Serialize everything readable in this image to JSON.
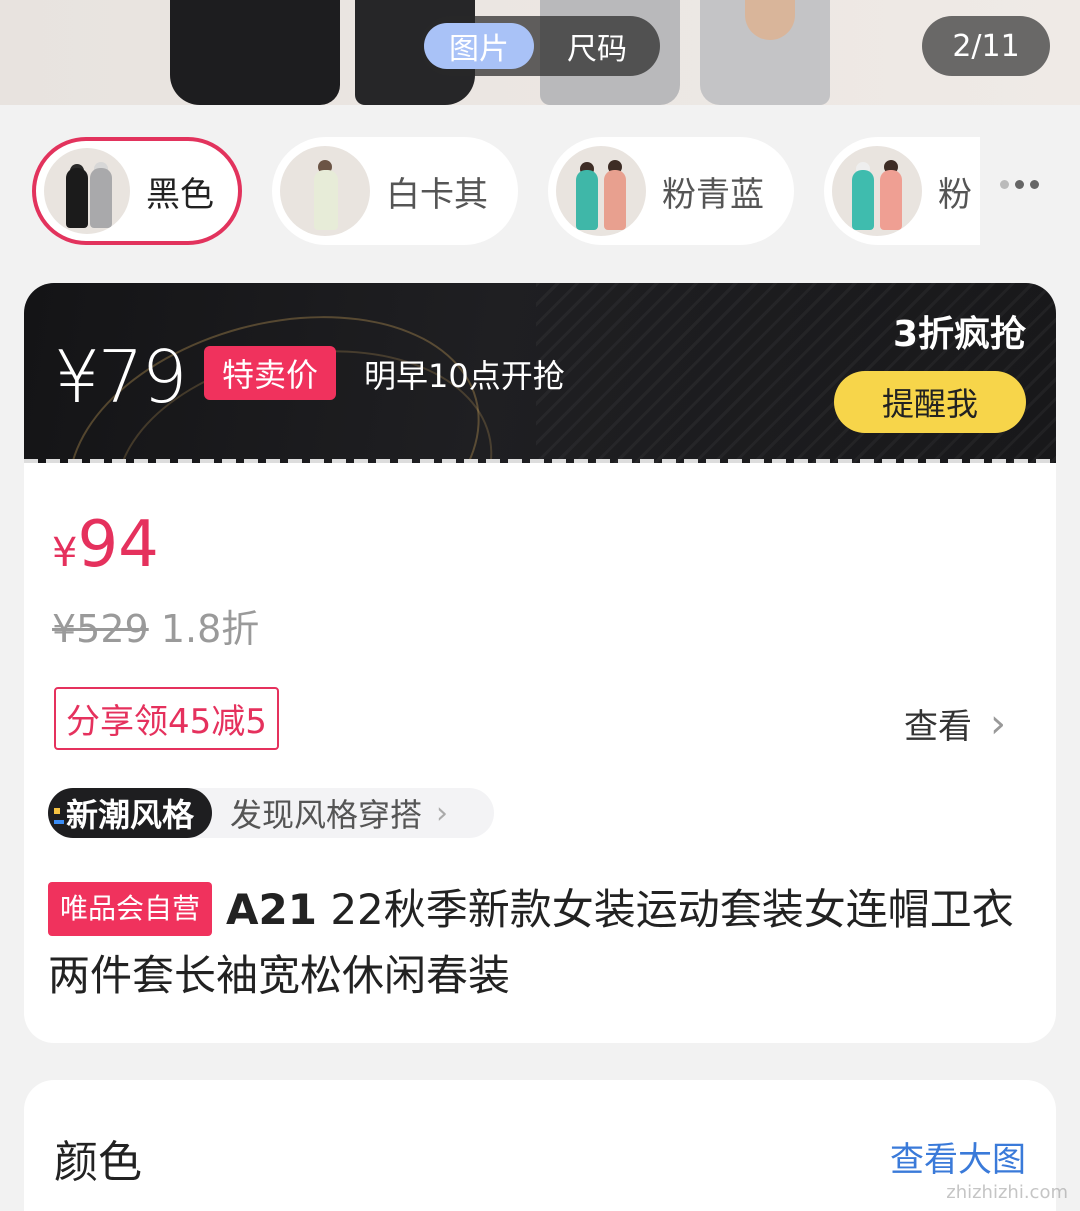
{
  "hero": {
    "tabs": [
      {
        "label": "图片",
        "active": true
      },
      {
        "label": "尺码",
        "active": false
      }
    ],
    "counter": "2/11"
  },
  "colors": [
    {
      "label": "黑色",
      "selected": true
    },
    {
      "label": "白卡其",
      "selected": false
    },
    {
      "label": "粉青蓝",
      "selected": false
    },
    {
      "label": "粉",
      "selected": false
    }
  ],
  "flash_sale": {
    "price": "¥79",
    "tag": "特卖价",
    "start_time": "明早10点开抢",
    "discount": "3折疯抢",
    "remind_button": "提醒我"
  },
  "product": {
    "currency": "¥",
    "price": "94",
    "original_price": "¥529",
    "discount": "1.8折",
    "coupon": "分享领45减5",
    "coupon_link": "查看",
    "style_badge": "新潮风格",
    "style_link": "发现风格穿搭",
    "seller_tag": "唯品会自营",
    "brand": "A21",
    "title": "22秋季新款女装运动套装女连帽卫衣两件套长袖宽松休闲春装"
  },
  "color_section": {
    "heading": "颜色",
    "link": "查看大图"
  },
  "watermark": "zhizhizhi.com",
  "theme": {
    "accent": "#e5315d",
    "remind_yellow": "#f7d54a",
    "link_blue": "#3a7ad9"
  }
}
